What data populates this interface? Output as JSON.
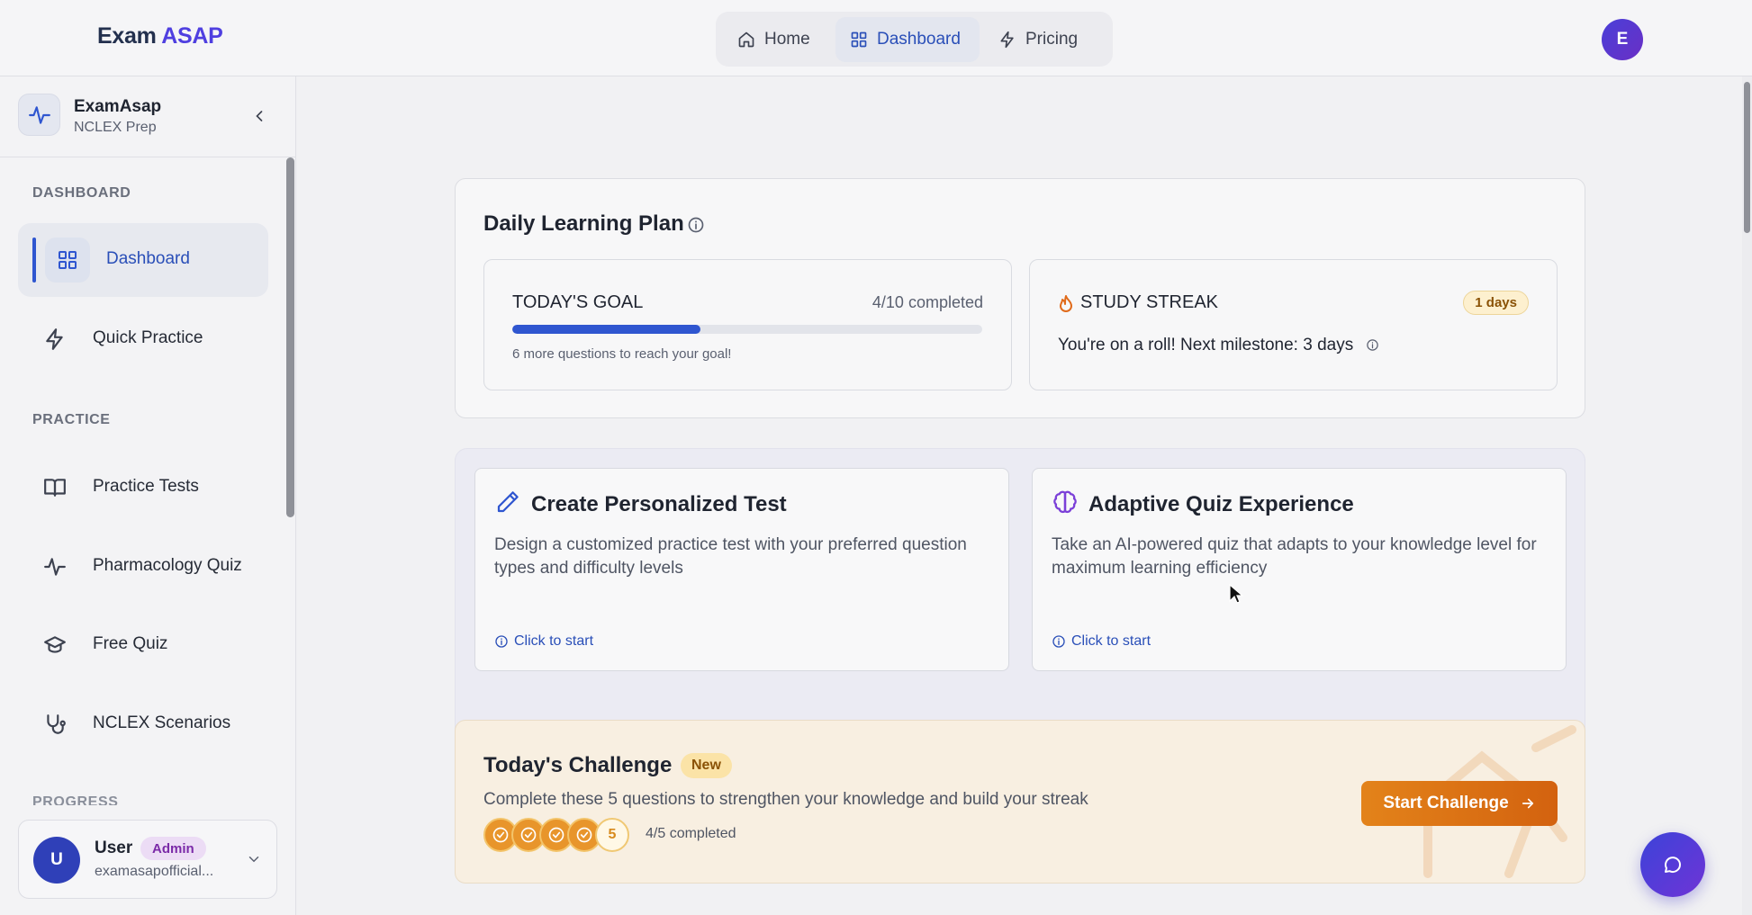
{
  "brand": {
    "part1": "Exam",
    "part2": "ASAP"
  },
  "topnav": {
    "items": [
      {
        "label": "Home",
        "icon": "home-icon"
      },
      {
        "label": "Dashboard",
        "icon": "grid-icon",
        "active": true
      },
      {
        "label": "Pricing",
        "icon": "lightning-icon"
      }
    ],
    "avatar_initial": "E"
  },
  "sidebar": {
    "app_name": "ExamAsap",
    "app_sub": "NCLEX Prep",
    "sections": [
      {
        "title": "DASHBOARD"
      },
      {
        "title": "PRACTICE"
      },
      {
        "title": "PROGRESS"
      }
    ],
    "items": [
      {
        "label": "Dashboard",
        "icon": "grid-icon",
        "active": true
      },
      {
        "label": "Quick Practice",
        "icon": "lightning-icon"
      },
      {
        "label": "Practice Tests",
        "icon": "book-icon"
      },
      {
        "label": "Pharmacology Quiz",
        "icon": "pulse-icon"
      },
      {
        "label": "Free Quiz",
        "icon": "graduation-cap-icon"
      },
      {
        "label": "NCLEX Scenarios",
        "icon": "stethoscope-icon"
      }
    ],
    "user": {
      "initial": "U",
      "name": "User",
      "role": "Admin",
      "email": "examasapofficial..."
    }
  },
  "plan": {
    "title": "Daily Learning Plan",
    "goal": {
      "title": "TODAY'S GOAL",
      "count": "4/10 completed",
      "progress": 0.4,
      "hint": "6 more questions to reach your goal!"
    },
    "streak": {
      "title": "STUDY STREAK",
      "badge": "1 days",
      "message": "You're on a roll! Next milestone: 3 days"
    }
  },
  "features": [
    {
      "title": "Create Personalized Test",
      "desc": "Design a customized practice test with your preferred question types and difficulty levels",
      "link": "Click to start",
      "icon": "pencil-icon"
    },
    {
      "title": "Adaptive Quiz Experience",
      "desc": "Take an AI-powered quiz that adapts to your knowledge level for maximum learning efficiency",
      "link": "Click to start",
      "icon": "brain-icon"
    }
  ],
  "challenge": {
    "title": "Today's Challenge",
    "badge": "New",
    "desc": "Complete these 5 questions to strengthen your knowledge and build your streak",
    "completed_of": "4/5 completed",
    "remaining_label": "5",
    "button": "Start Challenge"
  },
  "colors": {
    "accent": "#2f56d0",
    "brand_purple": "#4f3fe0",
    "challenge_orange": "#e3831a"
  }
}
